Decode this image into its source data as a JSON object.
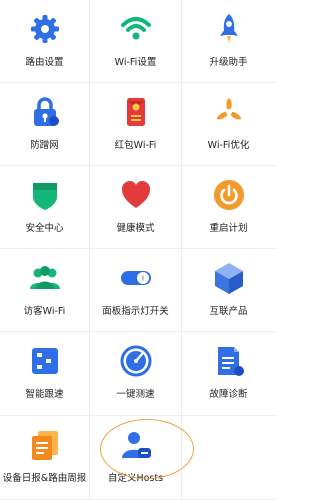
{
  "tiles": [
    {
      "label": "路由设置",
      "icon": "gear-icon"
    },
    {
      "label": "Wi-Fi设置",
      "icon": "wifi-icon"
    },
    {
      "label": "升级助手",
      "icon": "rocket-icon"
    },
    {
      "label": "防蹭网",
      "icon": "lock-icon"
    },
    {
      "label": "红包Wi-Fi",
      "icon": "red-envelope-icon"
    },
    {
      "label": "Wi-Fi优化",
      "icon": "fan-icon"
    },
    {
      "label": "安全中心",
      "icon": "shield-icon"
    },
    {
      "label": "健康模式",
      "icon": "heart-icon"
    },
    {
      "label": "重启计划",
      "icon": "power-icon"
    },
    {
      "label": "访客Wi-Fi",
      "icon": "guests-icon"
    },
    {
      "label": "面板指示灯开关",
      "icon": "toggle-icon"
    },
    {
      "label": "互联产品",
      "icon": "cube-icon"
    },
    {
      "label": "智能跟速",
      "icon": "speed-track-icon"
    },
    {
      "label": "一键测速",
      "icon": "speedometer-icon"
    },
    {
      "label": "故障诊断",
      "icon": "document-icon"
    },
    {
      "label": "设备日报&路由周报",
      "icon": "report-icon"
    },
    {
      "label": "自定义Hosts",
      "icon": "user-badge-icon"
    }
  ],
  "colors": {
    "blue": "#2f6fe6",
    "green": "#15b67a",
    "red": "#e33b3b",
    "orange": "#f39a2c",
    "highlight_ring": "#f0a040"
  }
}
